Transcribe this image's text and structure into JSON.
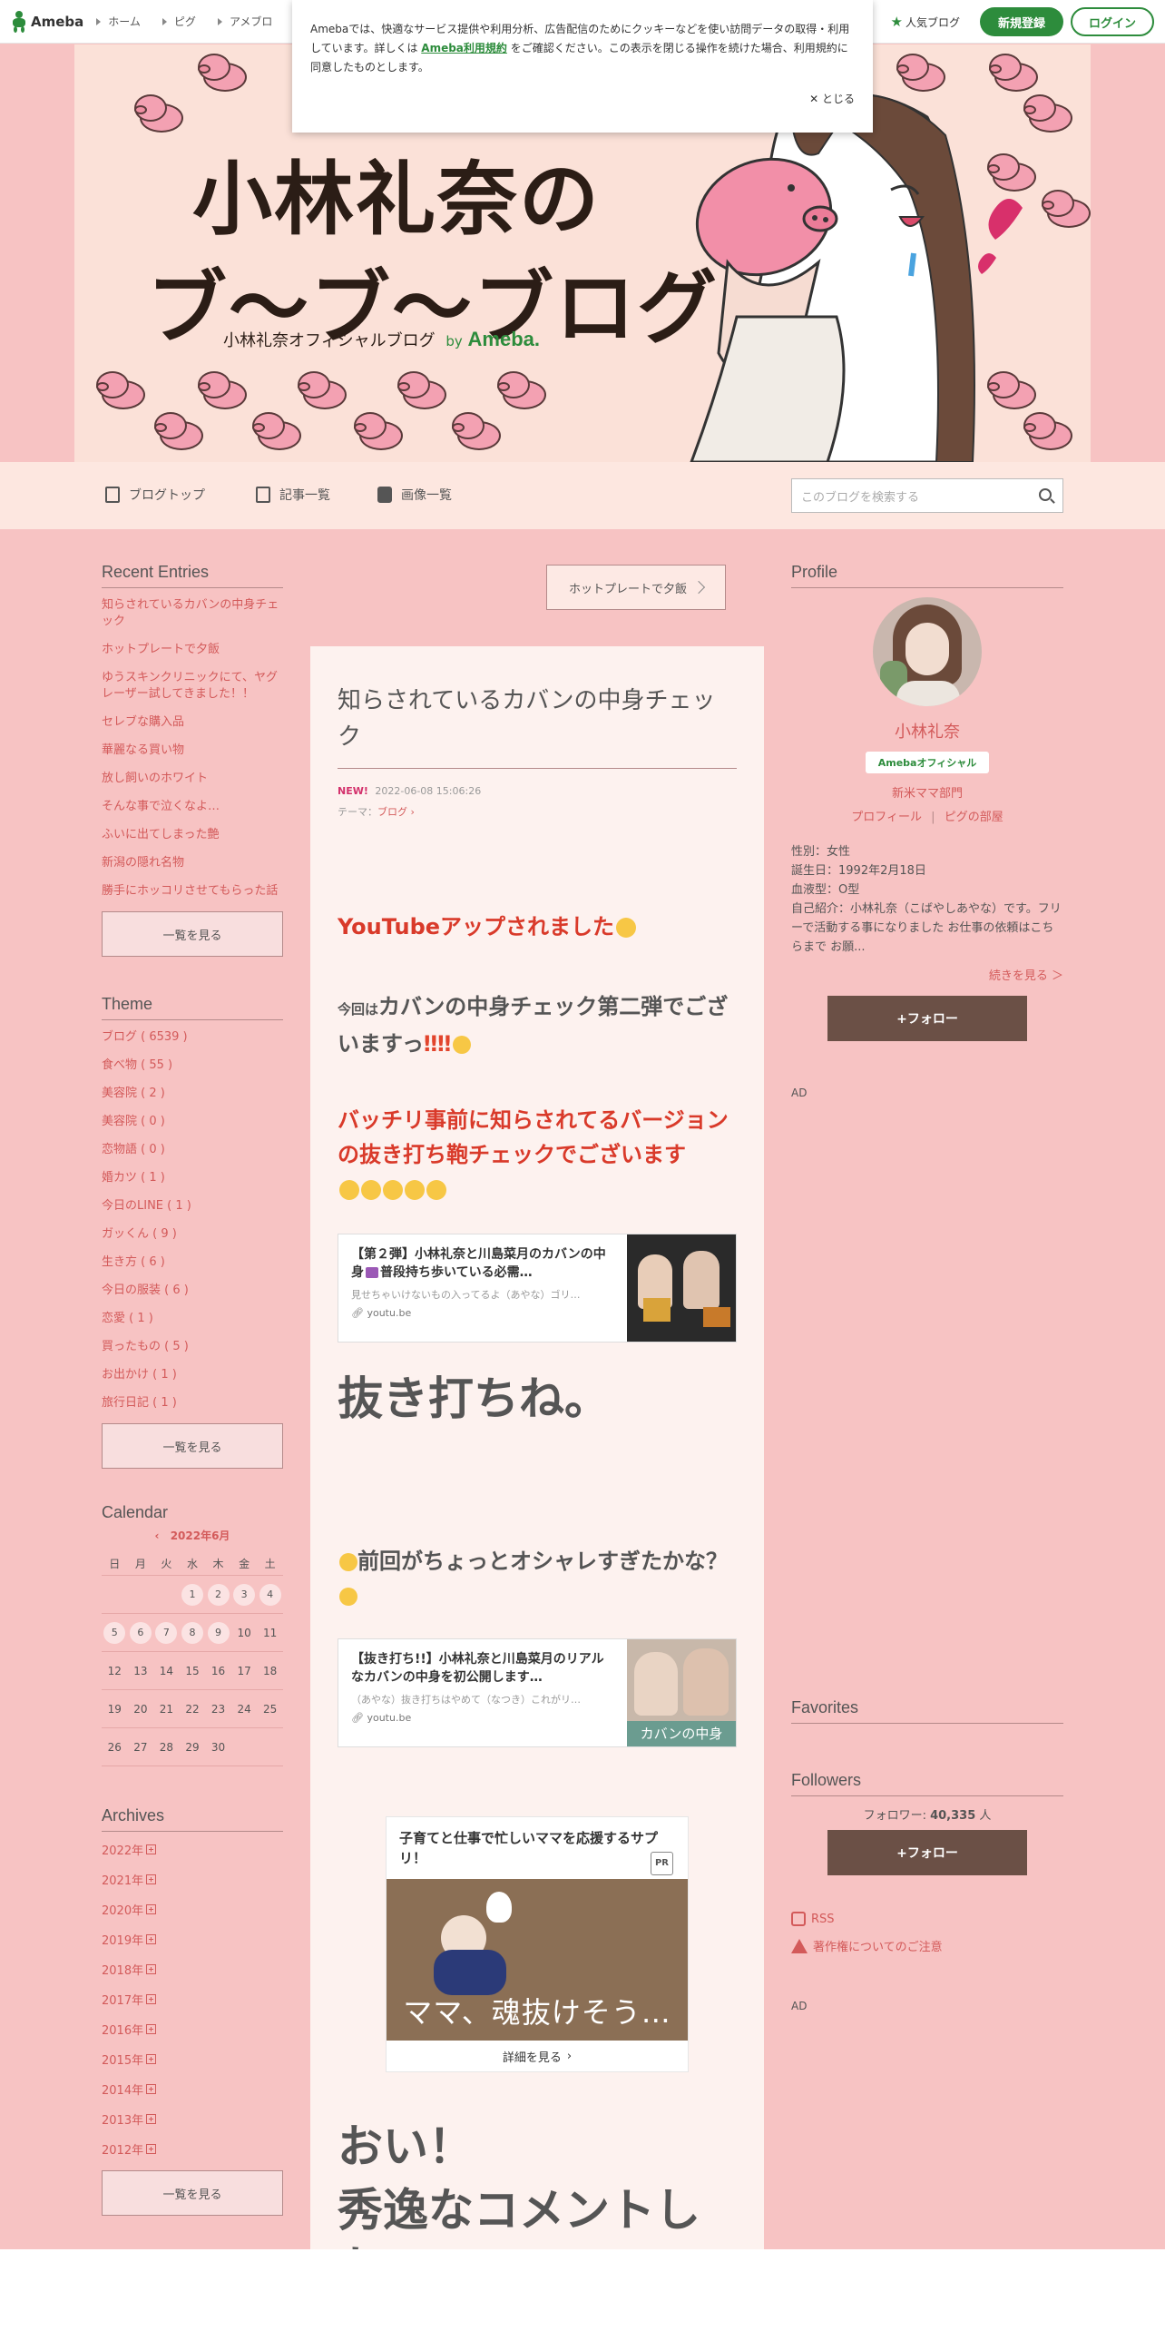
{
  "topnav": {
    "logo": "Ameba",
    "links": [
      "ホーム",
      "ピグ",
      "アメブロ"
    ],
    "popular": "人気ブログ",
    "signup": "新規登録",
    "login": "ログイン"
  },
  "cookie": {
    "text_before": "Amebaでは、快適なサービス提供や利用分析、広告配信のためにクッキーなどを使い訪問データの取得・利用しています。詳しくは",
    "link": "Ameba利用規約",
    "text_after": "をご確認ください。この表示を閉じる操作を続けた場合、利用規約に同意したものとします。",
    "close": "✕ とじる"
  },
  "banner": {
    "title_line1": "小林礼奈の",
    "title_line2": "ブ〜ブ〜ブログ",
    "subtitle": "小林礼奈オフィシャルブログ",
    "by": "by",
    "brand": "Ameba."
  },
  "blognav": {
    "top": "ブログトップ",
    "entries": "記事一覧",
    "images": "画像一覧",
    "search_placeholder": "このブログを検索する"
  },
  "left": {
    "recent_title": "Recent Entries",
    "recent": [
      "知らされているカバンの中身チェック",
      "ホットプレートで夕飯",
      "ゆうスキンクリニックにて、ヤグレーザー試してきました！！",
      "セレブな購入品",
      "華麗なる買い物",
      "放し飼いのホワイト",
      "そんな事で泣くなよ…",
      "ふいに出てしまった艶",
      "新潟の隠れ名物",
      "勝手にホッコリさせてもらった話"
    ],
    "see_all": "一覧を見る",
    "theme_title": "Theme",
    "themes": [
      "ブログ ( 6539 )",
      "食べ物 ( 55 )",
      "美容院 ( 2 )",
      "美容院 ( 0 )",
      "恋物語 ( 0 )",
      "婚カツ ( 1 )",
      "今日のLINE ( 1 )",
      "ガッくん ( 9 )",
      "生き方 ( 6 )",
      "今日の服装 ( 6 )",
      "恋愛 ( 1 )",
      "買ったもの ( 5 )",
      "お出かけ ( 1 )",
      "旅行日記 ( 1 )"
    ],
    "calendar_title": "Calendar",
    "calendar_month": "2022年6月",
    "weekdays": [
      "日",
      "月",
      "火",
      "水",
      "木",
      "金",
      "土"
    ],
    "weeks": [
      [
        "",
        "",
        "",
        "1",
        "2",
        "3",
        "4"
      ],
      [
        "5",
        "6",
        "7",
        "8",
        "9",
        "10",
        "11"
      ],
      [
        "12",
        "13",
        "14",
        "15",
        "16",
        "17",
        "18"
      ],
      [
        "19",
        "20",
        "21",
        "22",
        "23",
        "24",
        "25"
      ],
      [
        "26",
        "27",
        "28",
        "29",
        "30",
        "",
        ""
      ]
    ],
    "archives_title": "Archives",
    "archives": [
      "2022年",
      "2021年",
      "2020年",
      "2019年",
      "2018年",
      "2017年",
      "2016年",
      "2015年",
      "2014年",
      "2013年",
      "2012年"
    ]
  },
  "main": {
    "next": "ホットプレートで夕飯",
    "title": "知らされているカバンの中身チェック",
    "new": "NEW!",
    "date": "2022-06-08 15:06:26",
    "theme_label": "テーマ：",
    "theme": "ブログ",
    "h1": "YouTubeアップされました",
    "p2_prefix": "今回は",
    "p2": "カバンの中身チェック第二弾でございますっ",
    "h3": "バッチリ事前に知らされてるバージョンの抜き打ち鞄チェックでございます",
    "card1": {
      "title": "【第２弾】小林礼奈と川島菜月のカバンの中身",
      "title2": "普段持ち歩いている必需…",
      "desc": "見せちゃいけないもの入ってるよ（あやな）ゴリ…",
      "site": "youtu.be"
    },
    "huge1": "抜き打ちね。",
    "h4": "前回がちょっとオシャレすぎたかな？",
    "card2": {
      "title": "【抜き打ち!!】小林礼奈と川島菜月のリアルなカバンの中身を初公開します…",
      "desc": "（あやな）抜き打ちはやめて（なつき）これがリ…",
      "site": "youtu.be",
      "thumb_text": "カバンの中身"
    },
    "pr": {
      "title": "子育てと仕事で忙しいママを応援するサプリ！",
      "badge": "PR",
      "caption": "ママ、魂抜けそう…",
      "more": "詳細を見る"
    },
    "huge2": "おい！",
    "huge3": "秀逸なコメントした"
  },
  "right": {
    "profile_title": "Profile",
    "name": "小林礼奈",
    "official": "Amebaオフィシャル",
    "category": "新米ママ部門",
    "profile_link": "プロフィール",
    "pigg_link": "ピグの部屋",
    "sex": "性別：女性",
    "birthday": "誕生日：1992年2月18日",
    "blood": "血液型：O型",
    "intro": "自己紹介：小林礼奈（こばやしあやな）です。フリーで活動する事になりました お仕事の依頼はこちらまで お願...",
    "more": "続きを見る ＞",
    "follow": "+フォロー",
    "ad": "AD",
    "favorites_title": "Favorites",
    "followers_title": "Followers",
    "followers_label": "フォロワー:",
    "followers_count": "40,335",
    "followers_unit": "人",
    "rss": "RSS",
    "copyright": "著作権についてのご注意",
    "ad2": "AD"
  }
}
